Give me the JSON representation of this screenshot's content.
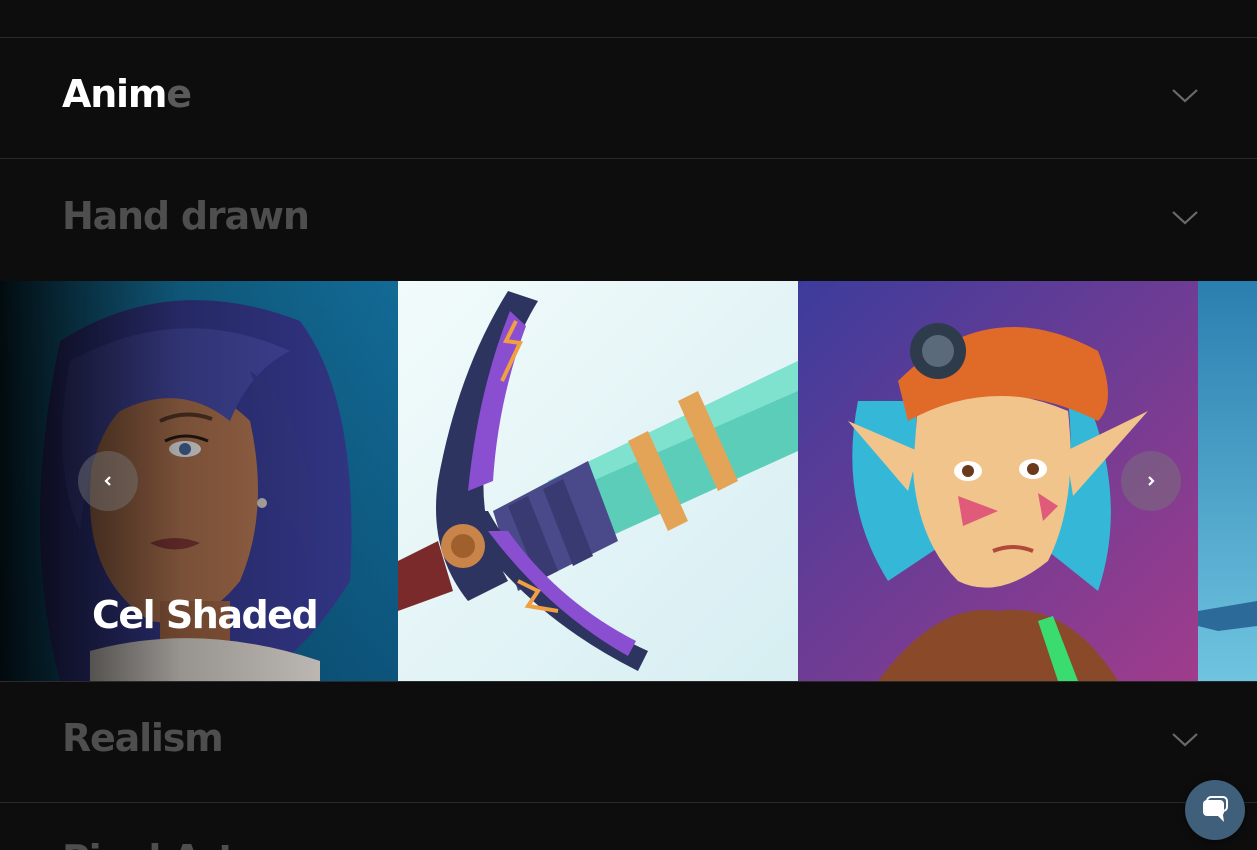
{
  "accordion": {
    "items": [
      {
        "title": "Anime",
        "title_active_part": "Anim",
        "title_fade_part": "e",
        "state": "expanded-animating"
      },
      {
        "title": "Hand drawn",
        "state": "collapsed"
      },
      {
        "title": "Realism",
        "state": "collapsed"
      },
      {
        "title": "Pixel Art",
        "state": "collapsed"
      }
    ]
  },
  "slider": {
    "slides": [
      {
        "label": "Cel Shaded",
        "image": "woman-blue-hair-portrait"
      },
      {
        "label": "",
        "image": "cartoon-pickaxe"
      },
      {
        "label": "",
        "image": "elf-girl-orange-helmet"
      },
      {
        "label": "",
        "image": "sky-landscape-partial"
      }
    ],
    "prev_icon": "chevron-left-icon",
    "next_icon": "chevron-right-icon"
  },
  "chat": {
    "icon": "chat-icon"
  },
  "colors": {
    "background": "#0d0d0d",
    "title_muted": "#4e4e4e",
    "title_active": "#ffffff",
    "chat_accent": "#3f5f7a"
  }
}
